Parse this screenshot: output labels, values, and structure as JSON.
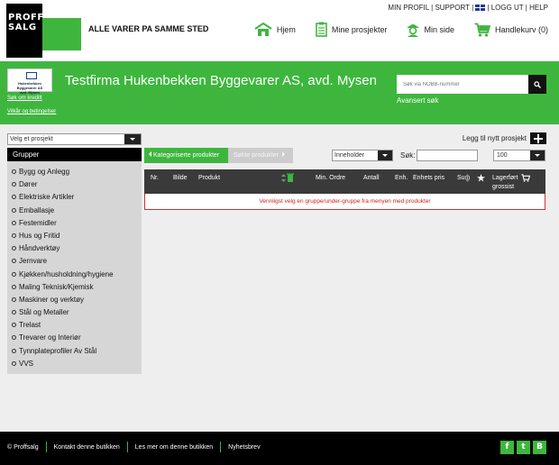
{
  "brand": {
    "logo_text_1": "PROFF",
    "logo_text_2": "SALG",
    "tagline": "ALLE VARER PA SAMME STED",
    "green": "#3eb63e"
  },
  "toplinks": {
    "profile": "MIN PROFIL",
    "support": "SUPPORT",
    "logout": "LOGG UT",
    "help": "HELP",
    "separator": "|"
  },
  "mainnav": {
    "home": "Hjem",
    "projects": "Mine prosjekter",
    "mypage": "Min side",
    "cart": "Handlekurv (0)"
  },
  "customer": {
    "logo_line_1": "Hukenbekken Byggevarer AS",
    "logo_line_2": "avd. Mysen",
    "company_name": "Testfirma Hukenbekken Byggevarer AS, avd. Mysen",
    "credit_link": "Søk om kreditt",
    "terms_link": "Vilkår og betingelser"
  },
  "search": {
    "placeholder": "Søk via NOBB-nummer",
    "advanced": "Avansert søk"
  },
  "project": {
    "select_value": "Velg et prosjekt",
    "new_project": "Legg til nytt prosjekt"
  },
  "sidebar": {
    "title": "Grupper",
    "items": [
      "Bygg og Anlegg",
      "Dører",
      "Elektriske Artikler",
      "Emballasje",
      "Festemidler",
      "Hus og Fritid",
      "Håndverktøy",
      "Jernvare",
      "Kjøkken/husholdning/hygiene",
      "Maling Teknisk/Kjemisk",
      "Maskiner og verktøy",
      "Stål og Metaller",
      "Trelast",
      "Trevarer og Interiør",
      "Tynnplateprofiler Av Stål",
      "VVS"
    ]
  },
  "tabs": {
    "categorized": "Kategoriserte produkter",
    "searched": "Søkte produkter"
  },
  "filters": {
    "contains": "Inneholder",
    "search_label": "Søk:",
    "page_size": "100"
  },
  "table": {
    "columns": {
      "nr": "Nr.",
      "image": "Bilde",
      "product": "Produkt",
      "min_order": "Min. Ordre",
      "quantity": "Antall",
      "unit": "Enh.",
      "unit_price": "Enhets pris",
      "sum": "Sum",
      "stock_1": "Lagerført",
      "stock_2": "grossist"
    },
    "empty_message": "Vennligst velg en gruppe/under-gruppe fra menyen med produkter"
  },
  "footer": {
    "copyright": "© Proffsalg",
    "contact": "Kontakt denne butikken",
    "about": "Les mer om denne butikken",
    "newsletter": "Nyhetsbrev"
  },
  "social": {
    "facebook": "f",
    "twitter": "t",
    "blog": "B"
  }
}
